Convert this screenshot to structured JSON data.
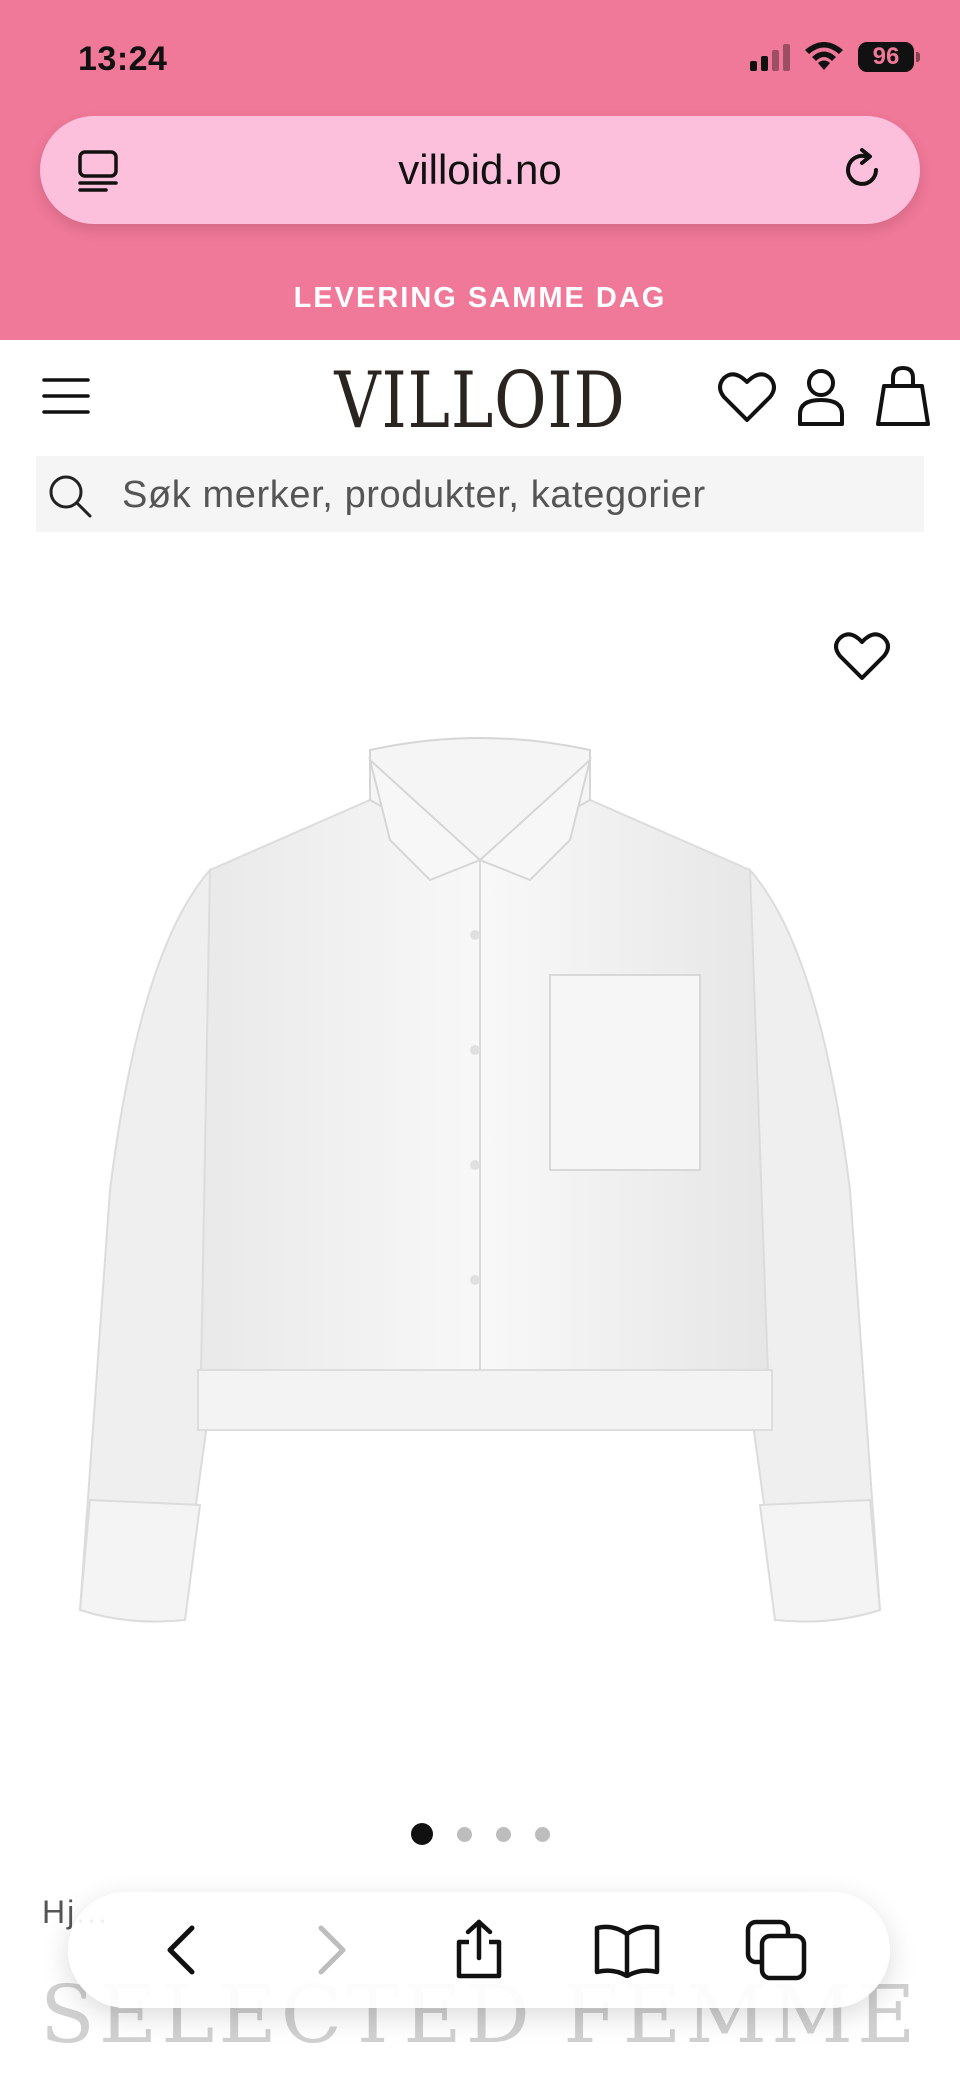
{
  "status_bar": {
    "time": "13:24",
    "battery": "96"
  },
  "browser": {
    "url": "villoid.no"
  },
  "promo": {
    "text": "LEVERING SAMME DAG"
  },
  "site_header": {
    "logo": "VILLOID"
  },
  "search": {
    "placeholder": "Søk merker, produkter, kategorier"
  },
  "product": {
    "image_description": "white cropped button-up shirt",
    "carousel": {
      "total": 4,
      "active_index": 0
    },
    "breadcrumb": "Hj...",
    "brand": "SELECTED FEMME"
  },
  "colors": {
    "pink_header": "#f07898",
    "url_bar_pink": "#fcc0dc",
    "text_dark": "#111111"
  },
  "icons": [
    "tabs-overview-icon",
    "reload-icon",
    "menu-icon",
    "heart-icon",
    "user-icon",
    "shopping-bag-icon",
    "search-icon",
    "back-icon",
    "forward-icon",
    "share-icon",
    "bookmarks-icon",
    "tabs-icon"
  ]
}
